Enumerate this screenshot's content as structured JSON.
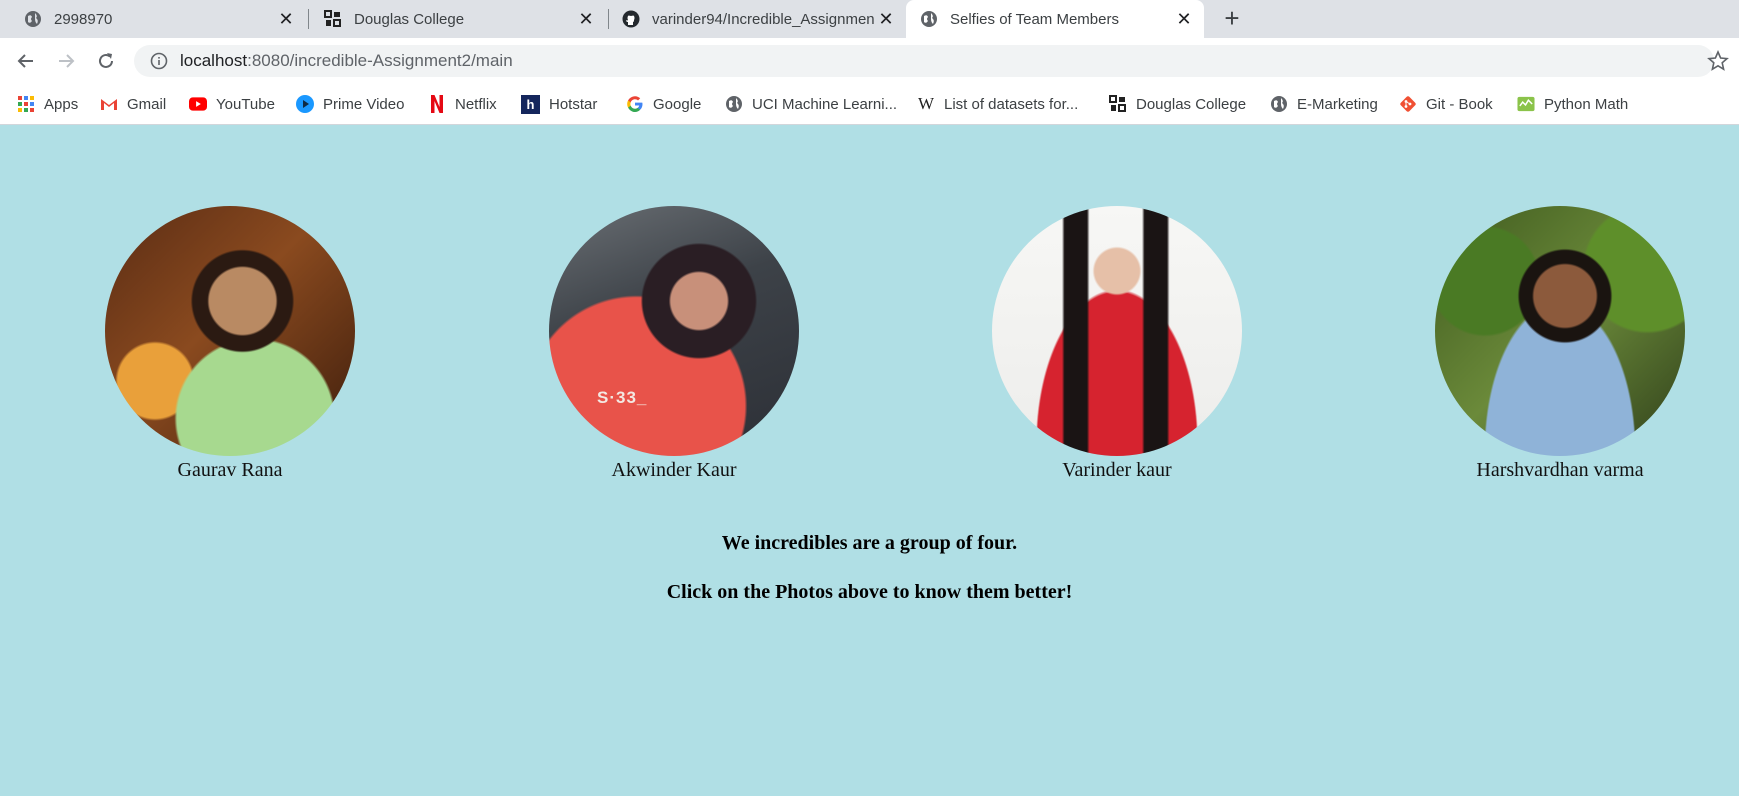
{
  "browser": {
    "tabs": [
      {
        "title": "2998970",
        "favicon": "globe-icon",
        "active": false
      },
      {
        "title": "Douglas College",
        "favicon": "douglas-college-icon",
        "active": false
      },
      {
        "title": "varinder94/Incredible_Assignmen",
        "favicon": "github-icon",
        "active": false
      },
      {
        "title": "Selfies of Team Members",
        "favicon": "globe-icon",
        "active": true
      }
    ],
    "url_host": "localhost",
    "url_rest": ":8080/incredible-Assignment2/main",
    "bookmarks": [
      {
        "label": "Apps",
        "icon": "apps-grid-icon"
      },
      {
        "label": "Gmail",
        "icon": "gmail-icon"
      },
      {
        "label": "YouTube",
        "icon": "youtube-icon"
      },
      {
        "label": "Prime Video",
        "icon": "prime-video-icon"
      },
      {
        "label": "Netflix",
        "icon": "netflix-icon"
      },
      {
        "label": "Hotstar",
        "icon": "hotstar-icon"
      },
      {
        "label": "Google",
        "icon": "google-icon"
      },
      {
        "label": "UCI Machine Learni...",
        "icon": "globe-icon"
      },
      {
        "label": "List of datasets for...",
        "icon": "wikipedia-icon"
      },
      {
        "label": "Douglas College",
        "icon": "douglas-college-icon"
      },
      {
        "label": "E-Marketing",
        "icon": "globe-icon"
      },
      {
        "label": "Git - Book",
        "icon": "git-icon"
      },
      {
        "label": "Python Math",
        "icon": "python-math-icon"
      }
    ]
  },
  "page": {
    "background": "#b0dfe5",
    "members": [
      {
        "name": "Gaurav Rana"
      },
      {
        "name": "Akwinder Kaur"
      },
      {
        "name": "Varinder kaur"
      },
      {
        "name": "Harshvardhan varma"
      }
    ],
    "intro": "We incredibles are a group of four.",
    "cta": "Click on the Photos above to know them better!"
  }
}
